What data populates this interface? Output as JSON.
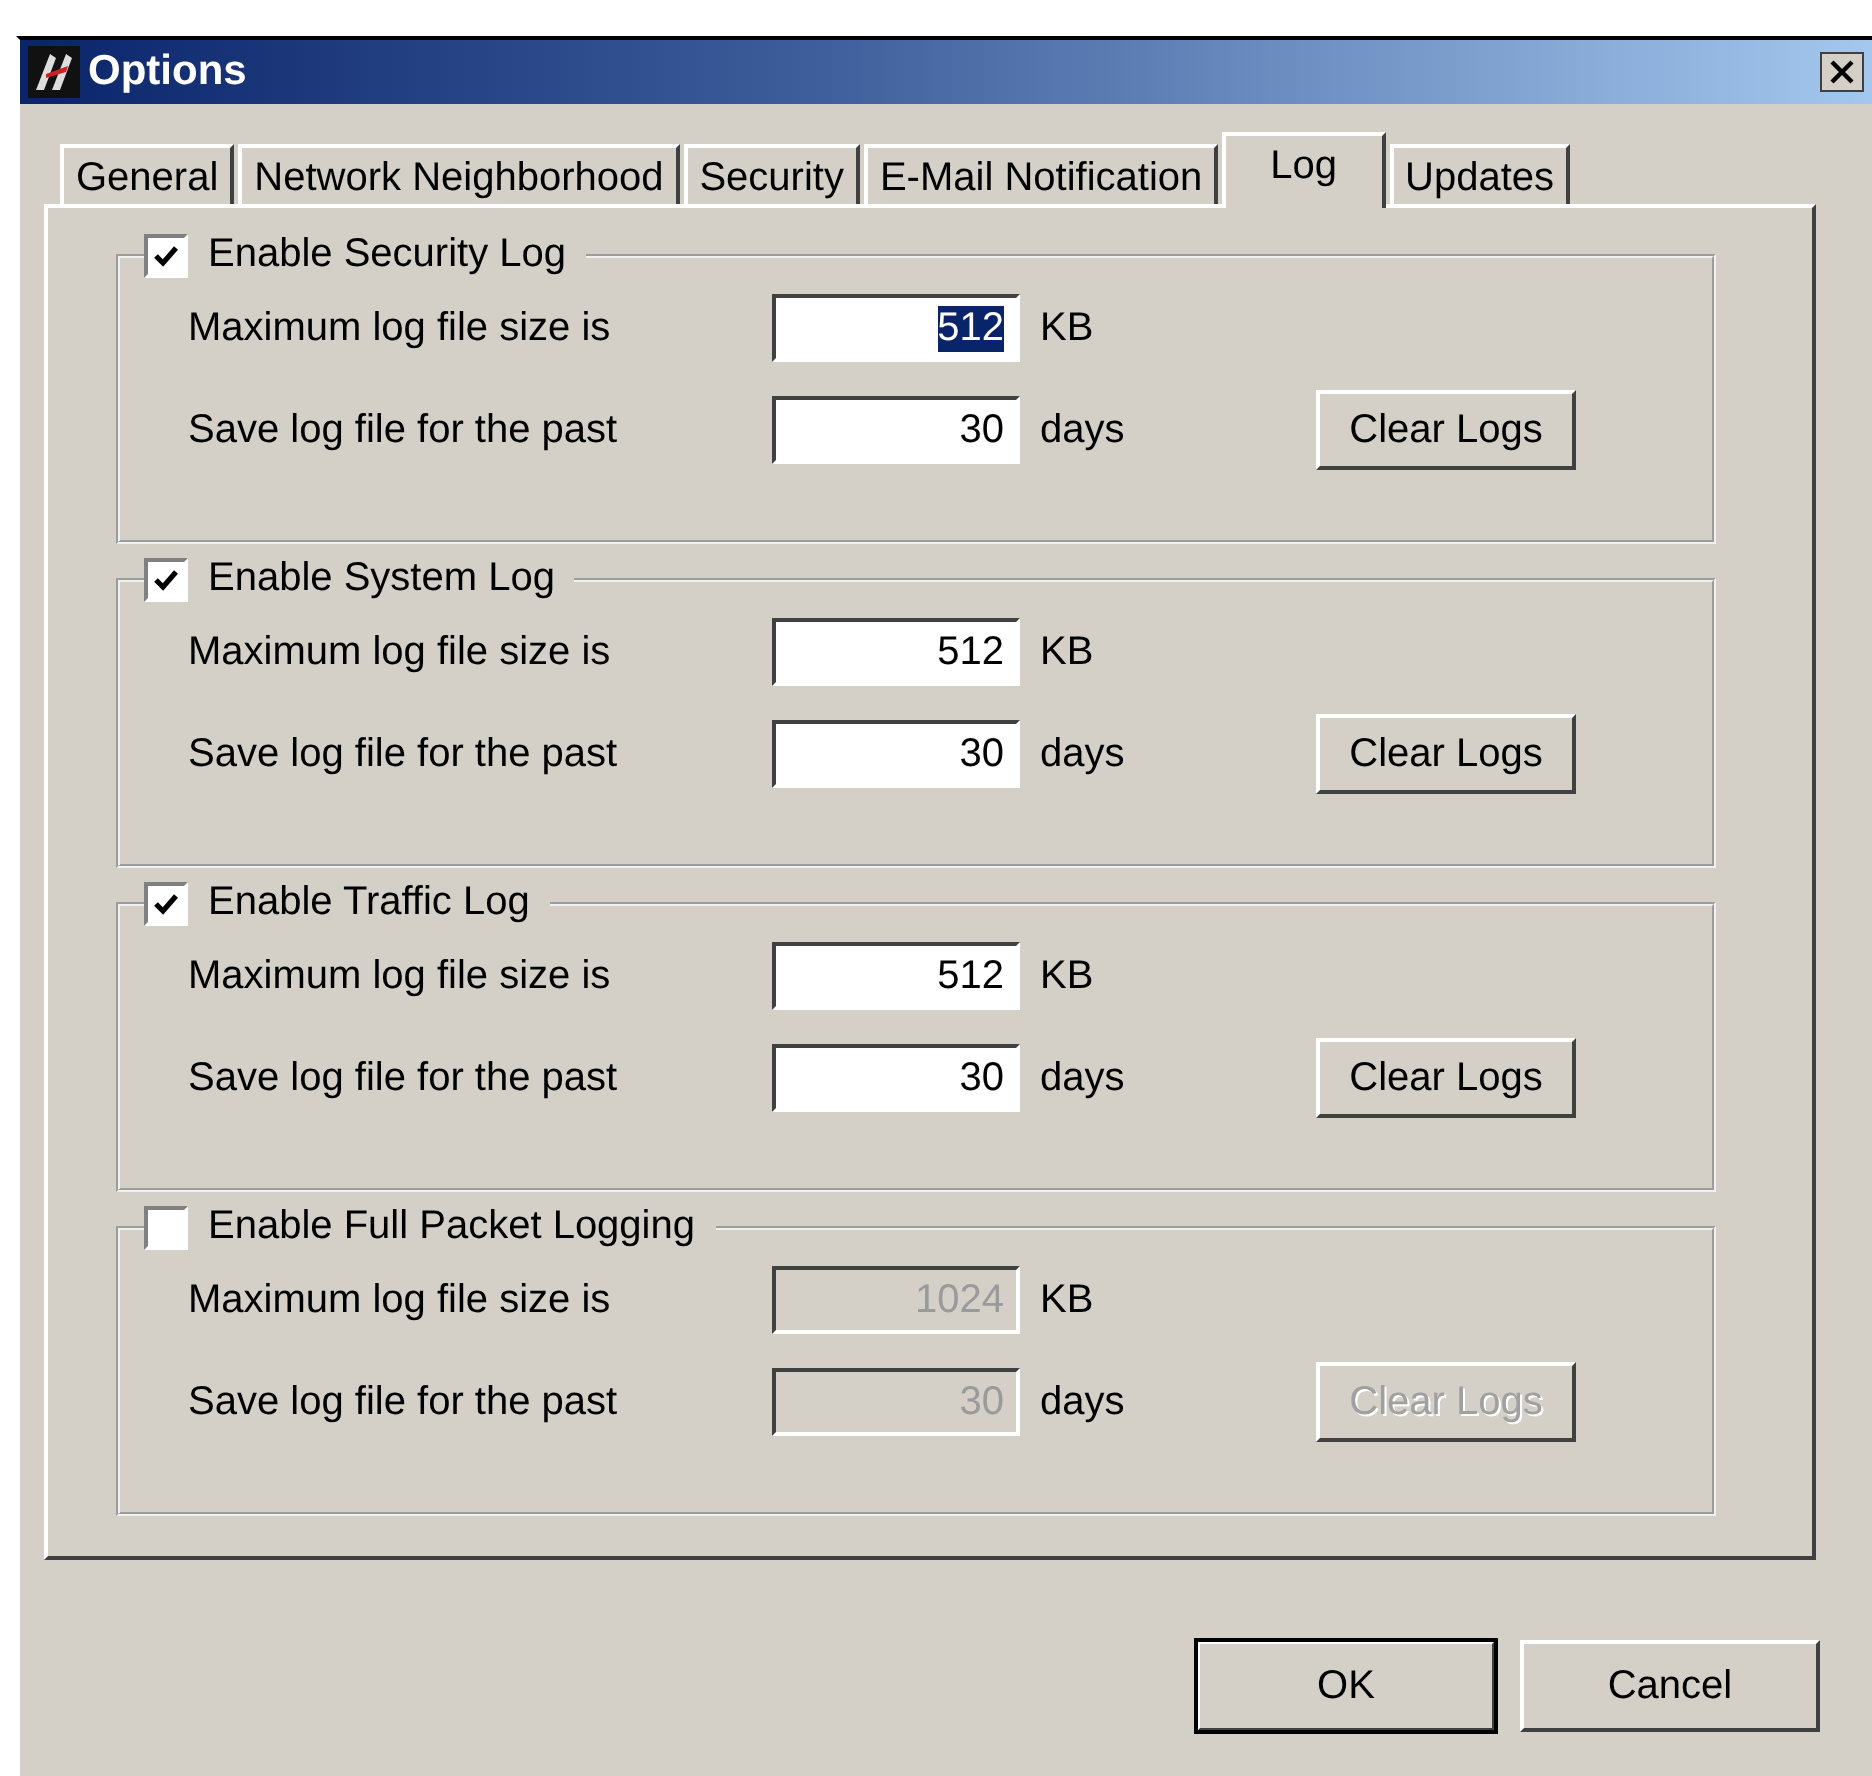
{
  "window": {
    "title": "Options"
  },
  "tabs": [
    {
      "label": "General",
      "selected": false
    },
    {
      "label": "Network Neighborhood",
      "selected": false
    },
    {
      "label": "Security",
      "selected": false
    },
    {
      "label": "E-Mail Notification",
      "selected": false
    },
    {
      "label": "Log",
      "selected": true
    },
    {
      "label": "Updates",
      "selected": false
    }
  ],
  "groups": [
    {
      "label": "Enable Security Log",
      "checked": true,
      "disabled": false,
      "fields": [
        {
          "label": "Maximum log file size is",
          "value": "512",
          "unit": "KB",
          "selected": true
        },
        {
          "label": "Save log file for the past",
          "value": "30",
          "unit": "days",
          "selected": false
        }
      ],
      "button": "Clear Logs"
    },
    {
      "label": "Enable System Log",
      "checked": true,
      "disabled": false,
      "fields": [
        {
          "label": "Maximum log file size is",
          "value": "512",
          "unit": "KB",
          "selected": false
        },
        {
          "label": "Save log file for the past",
          "value": "30",
          "unit": "days",
          "selected": false
        }
      ],
      "button": "Clear Logs"
    },
    {
      "label": "Enable Traffic Log",
      "checked": true,
      "disabled": false,
      "fields": [
        {
          "label": "Maximum log file size is",
          "value": "512",
          "unit": "KB",
          "selected": false
        },
        {
          "label": "Save log file for the past",
          "value": "30",
          "unit": "days",
          "selected": false
        }
      ],
      "button": "Clear Logs"
    },
    {
      "label": "Enable Full Packet Logging",
      "checked": false,
      "disabled": true,
      "fields": [
        {
          "label": "Maximum log file size is",
          "value": "1024",
          "unit": "KB",
          "selected": false
        },
        {
          "label": "Save log file for the past",
          "value": "30",
          "unit": "days",
          "selected": false
        }
      ],
      "button": "Clear Logs"
    }
  ],
  "buttons": [
    {
      "label": "OK",
      "default": true
    },
    {
      "label": "Cancel",
      "default": false
    }
  ]
}
